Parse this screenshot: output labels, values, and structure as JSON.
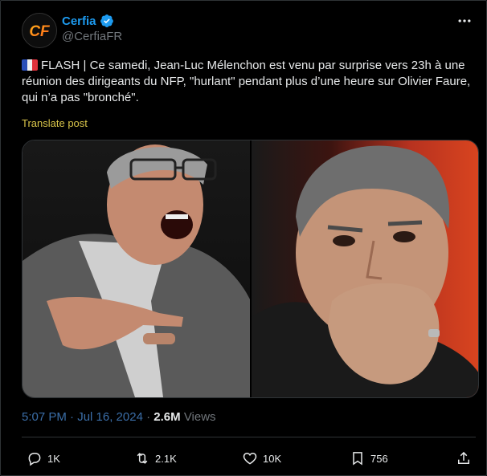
{
  "author": {
    "display_name": "Cerfia",
    "handle": "@CerfiaFR",
    "avatar_text": "CF",
    "verified_icon": "verified-badge-icon",
    "accent_color": "#1d9bf0"
  },
  "tweet": {
    "flag": "french-flag-icon",
    "text": "FLASH | Ce samedi, Jean-Luc Mélenchon est venu par surprise vers 23h à une réunion des dirigeants du NFP, \"hurlant\" pendant plus d’une heure sur Olivier Faure, qui n’a pas \"bronché\".",
    "translate_label": "Translate post",
    "time": "5:07 PM · Jul 16, 2024",
    "separator": " · ",
    "views_count": "2.6M",
    "views_label": "Views"
  },
  "media": [
    {
      "name": "photo-melenchon",
      "description_icon": "photo-shouting-man"
    },
    {
      "name": "photo-faure",
      "description_icon": "photo-thinking-man"
    }
  ],
  "actions": {
    "replies": "1K",
    "reposts": "2.1K",
    "likes": "10K",
    "bookmarks": "756"
  },
  "colors": {
    "background": "#000000",
    "muted": "#71767b",
    "translate": "#d9c54a",
    "time_link": "#3b6ea8"
  }
}
